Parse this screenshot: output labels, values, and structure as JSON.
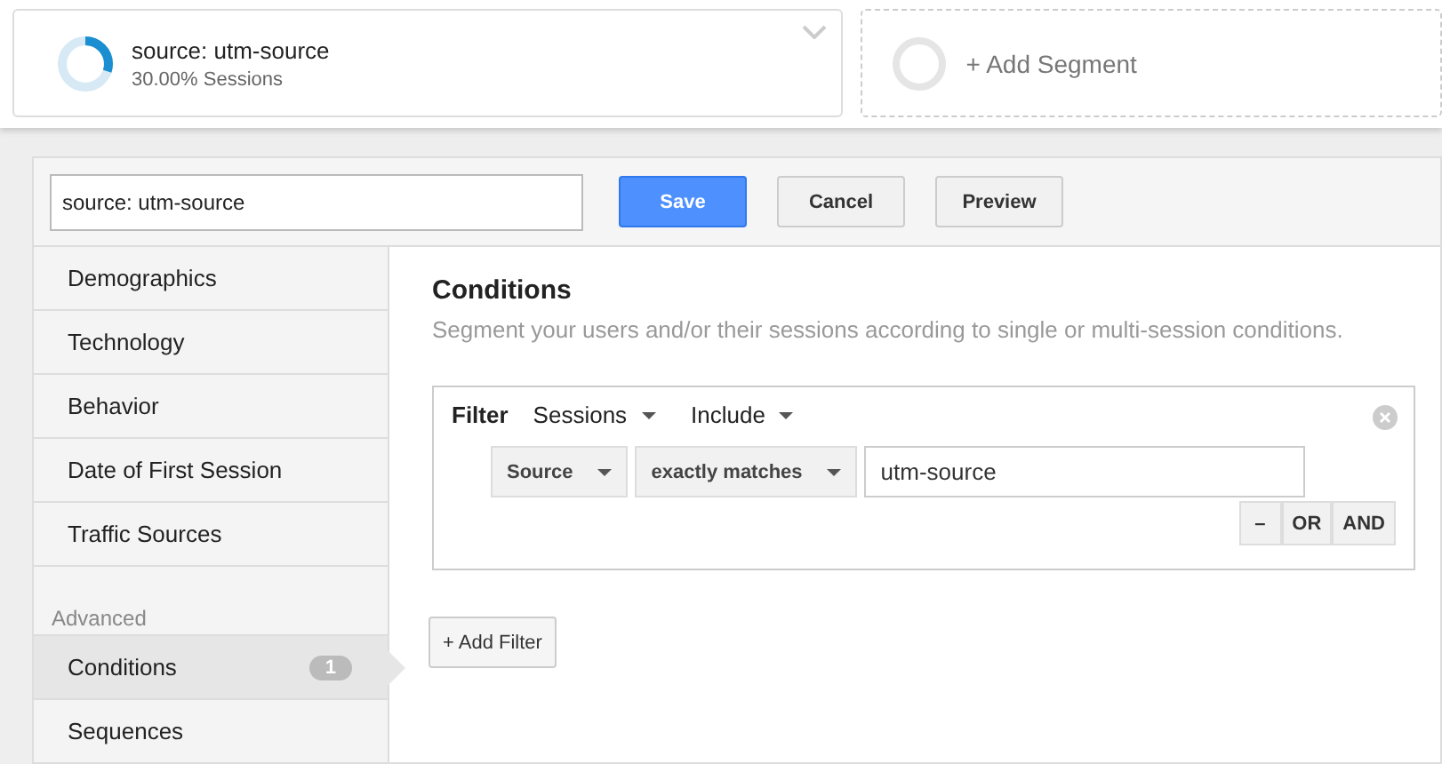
{
  "segments": [
    {
      "kind": "segment",
      "title": "source: utm-source",
      "subtitle": "30.00% Sessions"
    },
    {
      "kind": "add",
      "title": "+ Add Segment"
    }
  ],
  "toolbar": {
    "name_value": "source: utm-source",
    "buttons": [
      {
        "label": "Save",
        "kind": "primary"
      },
      {
        "label": "Cancel",
        "kind": "plain"
      },
      {
        "label": "Preview",
        "kind": "plain"
      }
    ]
  },
  "sidebar": {
    "groups": [
      {
        "items": [
          {
            "label": "Demographics",
            "selected": false
          },
          {
            "label": "Technology",
            "selected": false
          },
          {
            "label": "Behavior",
            "selected": false
          },
          {
            "label": "Date of First Session",
            "selected": false
          },
          {
            "label": "Traffic Sources",
            "selected": false
          }
        ]
      },
      {
        "heading": "Advanced",
        "items": [
          {
            "label": "Conditions",
            "selected": true,
            "badge": "1"
          },
          {
            "label": "Sequences",
            "selected": false
          }
        ]
      }
    ]
  },
  "content": {
    "title": "Conditions",
    "subtitle": "Segment your users and/or their sessions according to single or multi-session conditions.",
    "filter": {
      "label": "Filter",
      "scope": "Sessions",
      "mode": "Include",
      "dimension": "Source",
      "operator": "exactly matches",
      "value": "utm-source",
      "logic_buttons": [
        "–",
        "OR",
        "AND"
      ]
    },
    "add_filter": "+ Add Filter"
  }
}
